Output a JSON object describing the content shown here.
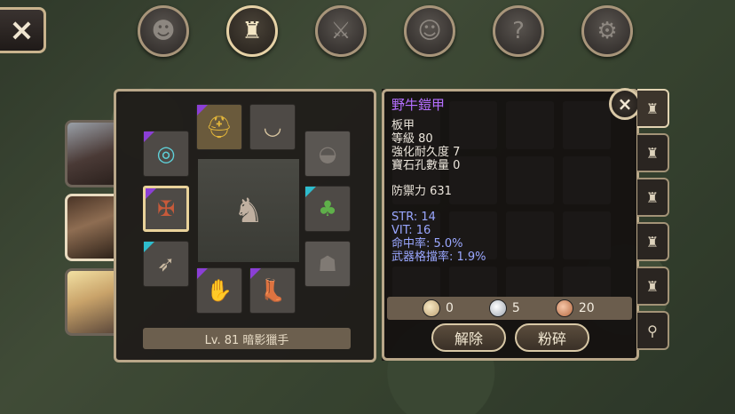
{
  "top_nav": {
    "close_icon": "×",
    "buttons": [
      {
        "icon": "head-profile-icon",
        "glyph": "☻",
        "active": false
      },
      {
        "icon": "bag-icon",
        "glyph": "♜",
        "active": true
      },
      {
        "icon": "sword-icon",
        "glyph": "⚔",
        "active": false
      },
      {
        "icon": "party-icon",
        "glyph": "☺",
        "active": false
      },
      {
        "icon": "scroll-icon",
        "glyph": "?",
        "active": false
      },
      {
        "icon": "gear-icon",
        "glyph": "⚙",
        "active": false
      }
    ]
  },
  "equipment": {
    "character_name": "Lv. 81 暗影獵手"
  },
  "tooltip": {
    "item_name": "野牛鎧甲",
    "lines": [
      "板甲",
      "等級 80",
      "強化耐久度 7",
      "寶石孔數量 0"
    ],
    "defense": "防禦力 631",
    "stats": [
      "STR: 14",
      "VIT: 16",
      "命中率: 5.0%",
      "武器格擋率: 1.9%"
    ],
    "close_icon": "×"
  },
  "cost": {
    "gold": "0",
    "silver": "5",
    "copper": "20"
  },
  "actions": {
    "remove_label": "解除",
    "shatter_label": "粉碎"
  },
  "colors": {
    "item_name": "#b56fff",
    "stat_text": "#9aa7ff",
    "frame": "#b9a789"
  }
}
